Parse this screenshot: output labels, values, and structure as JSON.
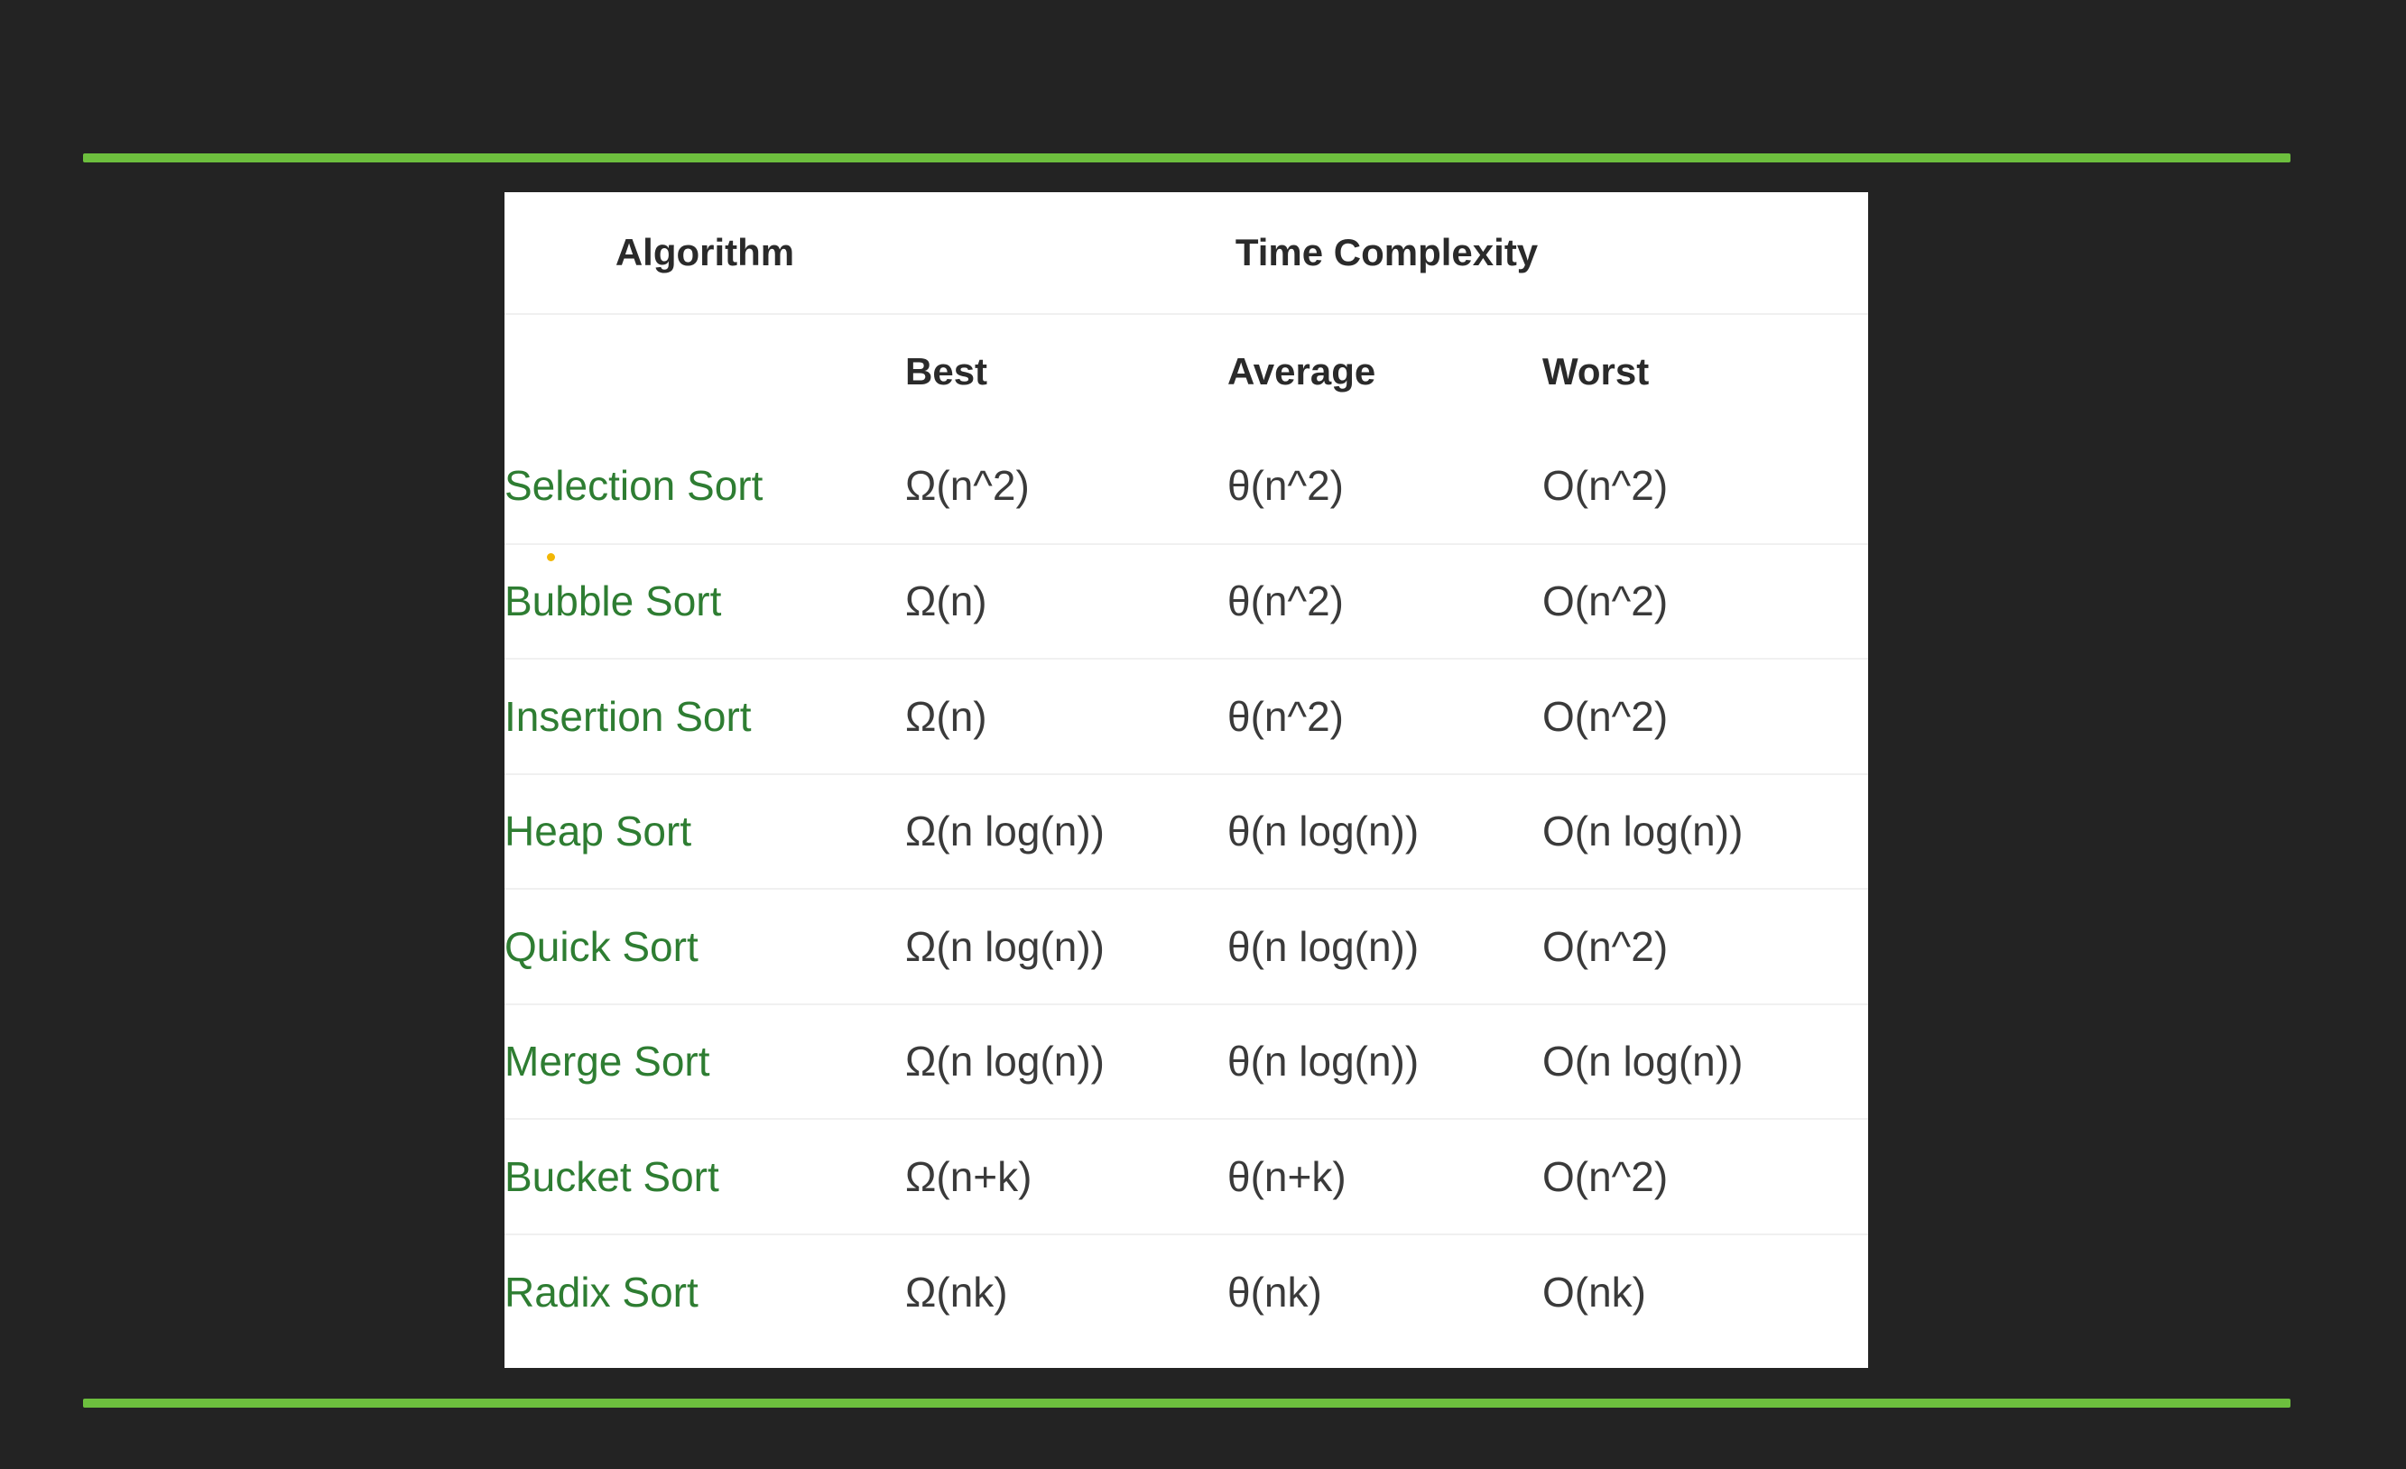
{
  "theme": {
    "background": "#232323",
    "rule_color": "#6dbf3e",
    "algorithm_color": "#2e7d32",
    "card_color": "#ffffff"
  },
  "table": {
    "header": {
      "algorithm": "Algorithm",
      "time_complexity": "Time Complexity",
      "best": "Best",
      "average": "Average",
      "worst": "Worst"
    },
    "rows": [
      {
        "algorithm": "Selection Sort",
        "best": "Ω(n^2)",
        "average": "θ(n^2)",
        "worst": "O(n^2)"
      },
      {
        "algorithm": "Bubble Sort",
        "best": "Ω(n)",
        "average": "θ(n^2)",
        "worst": "O(n^2)"
      },
      {
        "algorithm": "Insertion Sort",
        "best": "Ω(n)",
        "average": "θ(n^2)",
        "worst": "O(n^2)"
      },
      {
        "algorithm": "Heap Sort",
        "best": "Ω(n log(n))",
        "average": "θ(n log(n))",
        "worst": "O(n log(n))"
      },
      {
        "algorithm": "Quick Sort",
        "best": "Ω(n log(n))",
        "average": "θ(n log(n))",
        "worst": "O(n^2)"
      },
      {
        "algorithm": "Merge Sort",
        "best": "Ω(n log(n))",
        "average": "θ(n log(n))",
        "worst": "O(n log(n))"
      },
      {
        "algorithm": "Bucket Sort",
        "best": "Ω(n+k)",
        "average": "θ(n+k)",
        "worst": "O(n^2)"
      },
      {
        "algorithm": "Radix Sort",
        "best": "Ω(nk)",
        "average": "θ(nk)",
        "worst": "O(nk)"
      }
    ]
  }
}
